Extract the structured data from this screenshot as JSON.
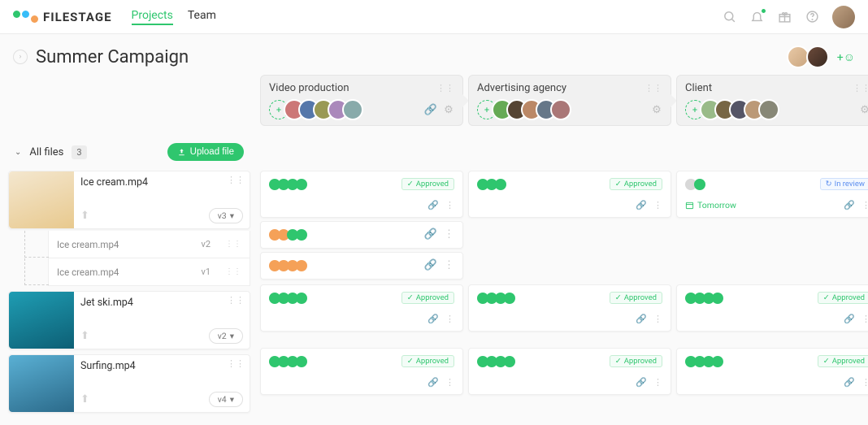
{
  "brand": "FILESTAGE",
  "colors": {
    "green": "#2fc66e",
    "orange": "#f5a158",
    "blue": "#5b8def"
  },
  "nav": {
    "items": [
      {
        "label": "Projects",
        "active": true
      },
      {
        "label": "Team",
        "active": false
      }
    ]
  },
  "project": {
    "title": "Summer Campaign"
  },
  "sidebar": {
    "all_files_label": "All files",
    "count": "3",
    "upload_label": "Upload file",
    "files": [
      {
        "name": "Ice cream.mp4",
        "version": "v3",
        "thumb": "icecream",
        "versions": [
          {
            "name": "Ice cream.mp4",
            "v": "v2"
          },
          {
            "name": "Ice cream.mp4",
            "v": "v1"
          }
        ]
      },
      {
        "name": "Jet ski.mp4",
        "version": "v2",
        "thumb": "jetski",
        "versions": []
      },
      {
        "name": "Surfing.mp4",
        "version": "v4",
        "thumb": "surf",
        "versions": []
      }
    ]
  },
  "stages": [
    {
      "name": "Video production",
      "reviewers": 5
    },
    {
      "name": "Advertising agency",
      "reviewers": 5
    },
    {
      "name": "Client",
      "reviewers": 5
    }
  ],
  "status": {
    "approved": "Approved",
    "in_review": "In review",
    "due": "Tomorrow"
  },
  "cells": {
    "stage0": [
      {
        "votes": [
          "g",
          "g",
          "g",
          "g"
        ],
        "status": "approved",
        "foot": true
      },
      {
        "votes": [
          "o",
          "o",
          "g",
          "g"
        ],
        "foot": true,
        "small": false,
        "h": 34
      },
      {
        "votes": [
          "o",
          "o",
          "o",
          "o"
        ],
        "foot": true,
        "small": false,
        "h": 34
      },
      {
        "votes": [
          "g",
          "g",
          "g",
          "g"
        ],
        "status": "approved",
        "foot": true
      },
      {
        "votes": [
          "g",
          "g",
          "g",
          "g"
        ],
        "status": "approved",
        "foot": true
      }
    ],
    "stage1": [
      {
        "votes": [
          "g",
          "g",
          "g"
        ],
        "status": "approved",
        "foot": true
      },
      {
        "votes": [
          "g",
          "g",
          "g",
          "g"
        ],
        "status": "approved",
        "foot": true
      },
      {
        "votes": [
          "g",
          "g",
          "g",
          "g"
        ],
        "status": "approved",
        "foot": true
      }
    ],
    "stage2": [
      {
        "votes": [
          "grey",
          "g"
        ],
        "status": "review",
        "due": true,
        "foot": true
      },
      {
        "votes": [
          "g",
          "g",
          "g",
          "g"
        ],
        "status": "approved",
        "foot": true
      },
      {
        "votes": [
          "g",
          "g",
          "g",
          "g"
        ],
        "status": "approved",
        "foot": true
      }
    ]
  }
}
